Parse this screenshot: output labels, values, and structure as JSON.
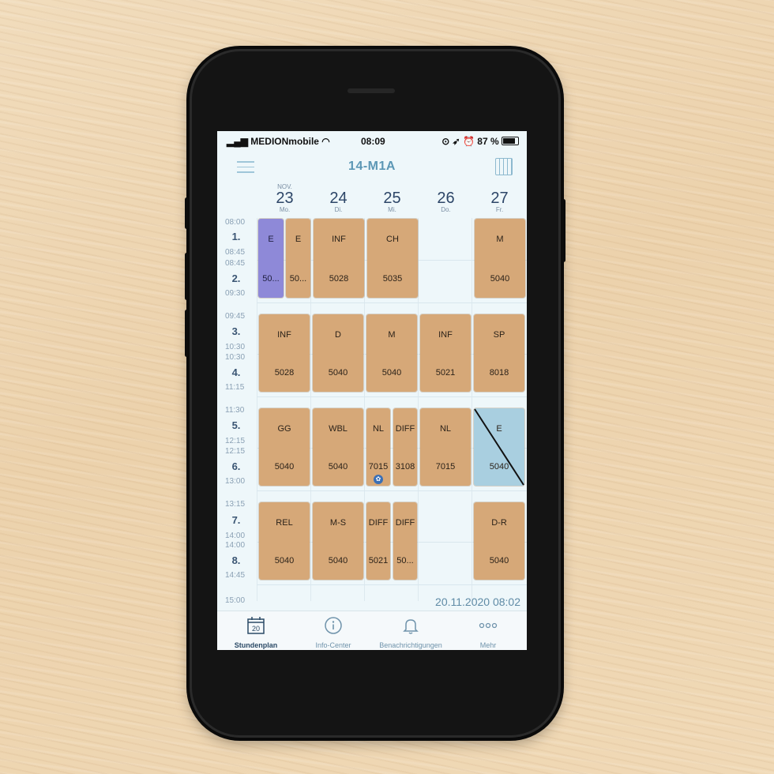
{
  "statusbar": {
    "carrier": "MEDIONmobile",
    "time": "08:09",
    "battery": "87 %"
  },
  "header": {
    "title": "14-M1A"
  },
  "days": [
    {
      "month": "NOV.",
      "num": "23",
      "name": "Mo."
    },
    {
      "month": "",
      "num": "24",
      "name": "Di."
    },
    {
      "month": "",
      "num": "25",
      "name": "Mi."
    },
    {
      "month": "",
      "num": "26",
      "name": "Do."
    },
    {
      "month": "",
      "num": "27",
      "name": "Fr."
    }
  ],
  "periods": [
    {
      "num": "1.",
      "start": "08:00",
      "end": "08:45"
    },
    {
      "num": "2.",
      "start": "08:45",
      "end": "09:30"
    },
    {
      "num": "3.",
      "start": "09:45",
      "end": "10:30"
    },
    {
      "num": "4.",
      "start": "10:30",
      "end": "11:15"
    },
    {
      "num": "5.",
      "start": "11:30",
      "end": "12:15"
    },
    {
      "num": "6.",
      "start": "12:15",
      "end": "13:00"
    },
    {
      "num": "7.",
      "start": "13:15",
      "end": "14:00"
    },
    {
      "num": "8.",
      "start": "14:00",
      "end": "14:45"
    }
  ],
  "end_time": "15:00",
  "lessons": {
    "mo_12a": {
      "subject": "E",
      "room": "50..."
    },
    "mo_12b": {
      "subject": "E",
      "room": "50..."
    },
    "di_12": {
      "subject": "INF",
      "room": "5028"
    },
    "mi_12": {
      "subject": "CH",
      "room": "5035"
    },
    "fr_12": {
      "subject": "M",
      "room": "5040"
    },
    "mo_34": {
      "subject": "INF",
      "room": "5028"
    },
    "di_34": {
      "subject": "D",
      "room": "5040"
    },
    "mi_34": {
      "subject": "M",
      "room": "5040"
    },
    "do_34": {
      "subject": "INF",
      "room": "5021"
    },
    "fr_34": {
      "subject": "SP",
      "room": "8018"
    },
    "mo_56": {
      "subject": "GG",
      "room": "5040"
    },
    "di_56": {
      "subject": "WBL",
      "room": "5040"
    },
    "mi_56a": {
      "subject": "NL",
      "room": "7015"
    },
    "mi_56b": {
      "subject": "DIFF",
      "room": "3108"
    },
    "do_56": {
      "subject": "NL",
      "room": "7015"
    },
    "fr_56": {
      "subject": "E",
      "room": "5040",
      "status": "cancelled"
    },
    "mo_78": {
      "subject": "REL",
      "room": "5040"
    },
    "di_78": {
      "subject": "M-S",
      "room": "5040"
    },
    "mi_78a": {
      "subject": "DIFF",
      "room": "5021"
    },
    "mi_78b": {
      "subject": "DIFF",
      "room": "50..."
    },
    "fr_78": {
      "subject": "D-R",
      "room": "5040"
    }
  },
  "last_update": "20.11.2020 08:02",
  "tabs": [
    {
      "label": "Stundenplan",
      "icon": "calendar-icon",
      "badge": "20",
      "active": true
    },
    {
      "label": "Info-Center",
      "icon": "info-icon"
    },
    {
      "label": "Benachrichtigungen",
      "icon": "bell-icon"
    },
    {
      "label": "Mehr",
      "icon": "more-icon"
    }
  ],
  "colors": {
    "lesson": "#d6a878",
    "selected": "#8e89d8",
    "cancelled": "#a9cfe0",
    "accent": "#5c97b5"
  }
}
